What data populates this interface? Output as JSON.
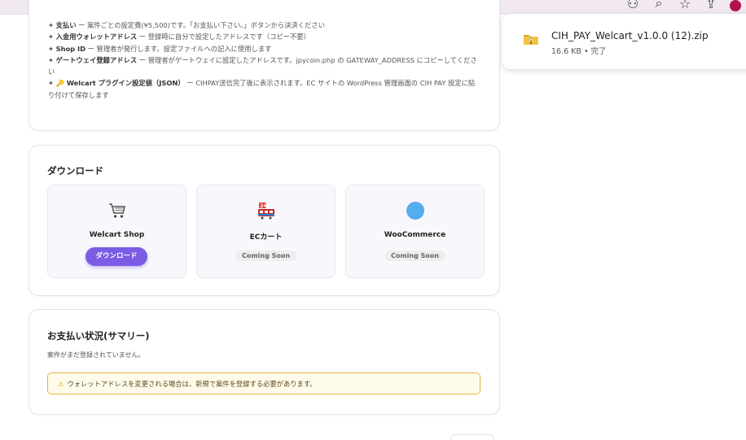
{
  "instructions": [
    {
      "label": "支払い",
      "text": " ー 案件ごとの設定費(¥5,500)です。「お支払い下さい。」ボタンから決済ください"
    },
    {
      "label": "入金用ウォレットアドレス",
      "text": " ー 登録時に自分で設定したアドレスです（コピー不要）"
    },
    {
      "label": "Shop ID",
      "text": " ー 管理者が発行します。設定ファイルへの記入に使用します"
    },
    {
      "label": "ゲートウェイ登録アドレス",
      "text": " ー 管理者がゲートウェイに設定したアドレスです。jpycoin.php の GATEWAY_ADDRESS にコピーしてください"
    },
    {
      "label": "🔑 Welcart プラグイン設定値（JSON）",
      "text": " ー CIHPAY送信完了後に表示されます。EC サイトの WordPress 管理画面の CIH PAY 設定に貼り付けて保存します"
    }
  ],
  "download": {
    "title": "ダウンロード",
    "tiles": [
      {
        "name": "Welcart Shop",
        "icon": "shopping-cart-icon",
        "action": "ダウンロード"
      },
      {
        "name": "ECカート",
        "icon": "ec-cart-icon",
        "badge": "Coming Soon"
      },
      {
        "name": "WooCommerce",
        "icon": "woocommerce-icon",
        "badge": "Coming Soon"
      }
    ]
  },
  "status": {
    "title": "お支払い状況(サマリー)",
    "empty_text": "案件がまだ登録されていません。",
    "warning": "ウォレットアドレスを変更される場合は、新規で案件を登録する必要があります。"
  },
  "download_panel": {
    "file_name": "CIH_PAY_Welcart_v1.0.0 (12).zip",
    "meta": "16.6 KB • 完了"
  },
  "colors": {
    "accent": "#7a5ce5",
    "warning_border": "#e2b646",
    "warning_bg": "#fffbea"
  }
}
